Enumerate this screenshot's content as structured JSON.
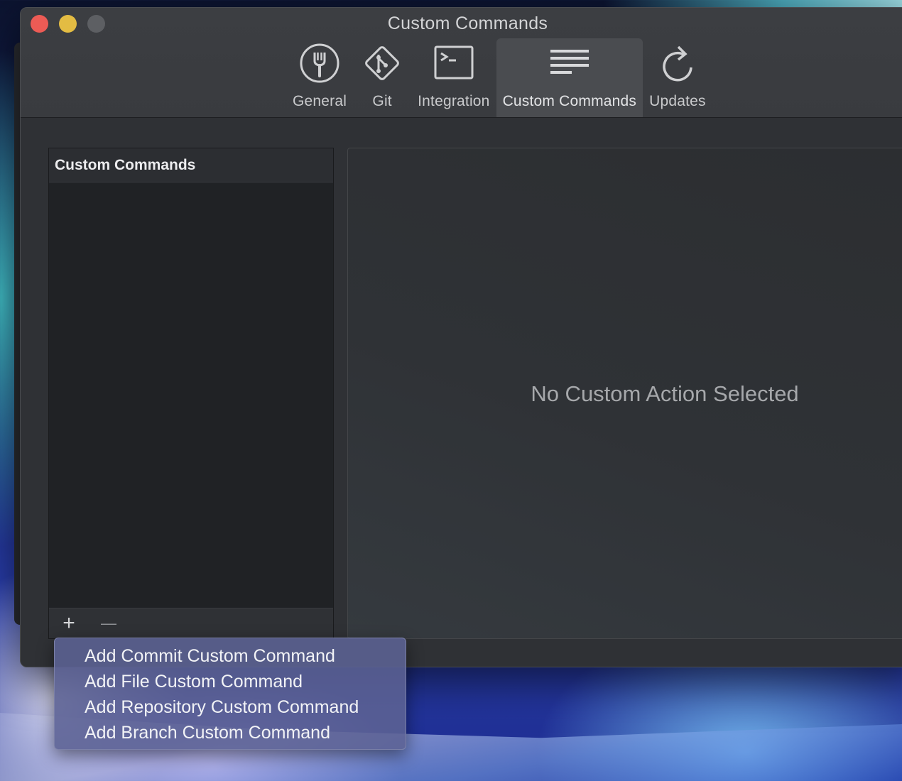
{
  "window": {
    "title": "Custom Commands"
  },
  "toolbar": {
    "items": [
      {
        "label": "General",
        "icon": "fork-icon"
      },
      {
        "label": "Git",
        "icon": "git-icon"
      },
      {
        "label": "Integration",
        "icon": "terminal-icon"
      },
      {
        "label": "Custom Commands",
        "icon": "lines-icon",
        "active": true
      },
      {
        "label": "Updates",
        "icon": "refresh-icon"
      }
    ]
  },
  "list": {
    "header": "Custom Commands",
    "add_symbol": "+",
    "remove_symbol": "—"
  },
  "detail": {
    "empty_message": "No Custom Action Selected"
  },
  "menu": {
    "items": [
      "Add Commit Custom Command",
      "Add File Custom Command",
      "Add Repository Custom Command",
      "Add Branch Custom Command"
    ]
  }
}
